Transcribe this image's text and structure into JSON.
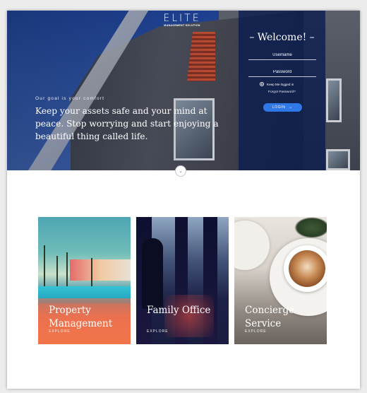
{
  "brand": {
    "name": "ELITE",
    "subtitle": "MANAGEMENT SOLUTION"
  },
  "hero": {
    "tagline": "Our goal is your comfort",
    "headline": "Keep your assets safe and your mind at peace. Stop worrying and start enjoying a beautiful thing called life."
  },
  "login": {
    "title": "– Welcome! –",
    "username_placeholder": "Username",
    "password_placeholder": "Password",
    "remember_label": "Keep Me logged in",
    "forgot_label": "Forgot Password?",
    "button_label": "LOGIN",
    "button_color": "#2f78e6"
  },
  "scroll_icon": "chevron-down-icon",
  "cards": [
    {
      "title": "Property Management",
      "explore": "EXPLORE"
    },
    {
      "title": "Family Office",
      "explore": "EXPLORE"
    },
    {
      "title": "Concierge Service",
      "explore": "EXPLORE"
    }
  ]
}
